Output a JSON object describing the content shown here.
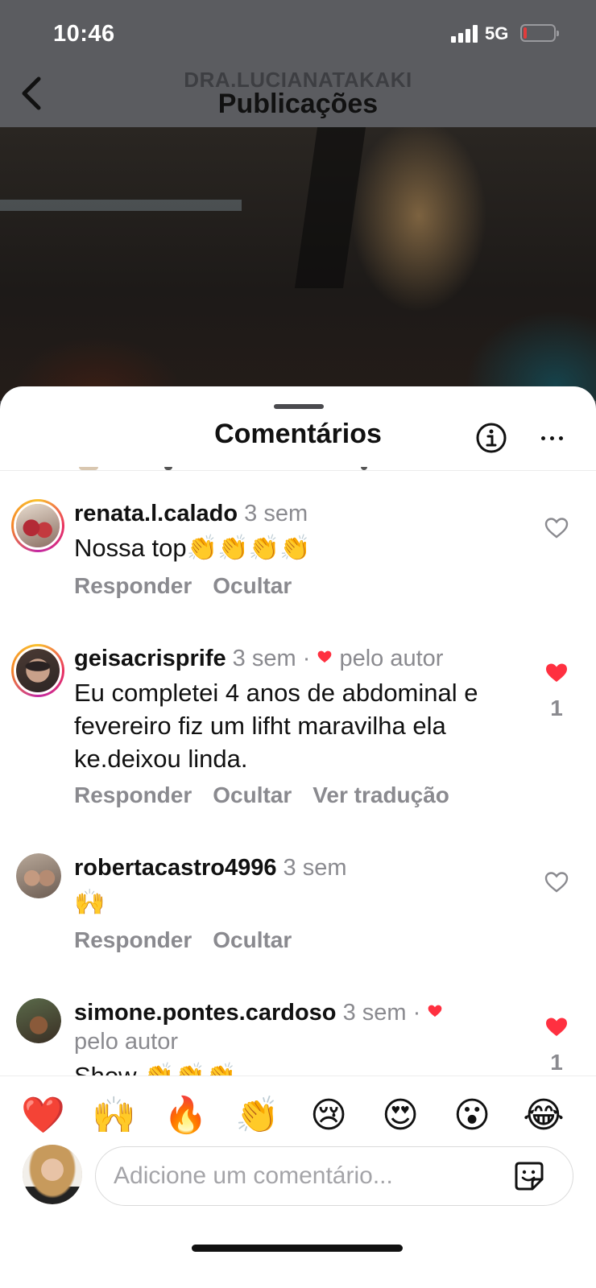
{
  "status_bar": {
    "time": "10:46",
    "network": "5G",
    "battery_icon": "battery-low-icon"
  },
  "header": {
    "account": "DRA.LUCIANATAKAKI",
    "title": "Publicações"
  },
  "sheet": {
    "title": "Comentários"
  },
  "colors": {
    "like_red": "#ff3040",
    "meta_gray": "#8a8a8f"
  },
  "comments": [
    {
      "username": "renata.l.calado",
      "time": "3 sem",
      "text": "Nossa top👏👏👏👏",
      "actions": [
        "Responder",
        "Ocultar"
      ],
      "liked": false,
      "like_count": ""
    },
    {
      "username": "geisacrisprife",
      "time": "3 sem ·",
      "author_like": "pelo autor",
      "text": "Eu completei 4 anos de abdominal e fevereiro fiz um lifht maravilha ela ke.deixou linda.",
      "actions": [
        "Responder",
        "Ocultar",
        "Ver tradução"
      ],
      "liked": true,
      "like_count": "1"
    },
    {
      "username": "robertacastro4996",
      "time": "3 sem",
      "text": "🙌",
      "actions": [
        "Responder",
        "Ocultar"
      ],
      "liked": false,
      "like_count": ""
    },
    {
      "username": "simone.pontes.cardoso",
      "time": "3 sem ·",
      "author_like": "pelo autor",
      "text": "Show 👏👏👏",
      "actions": [],
      "liked": true,
      "like_count": "1"
    }
  ],
  "emoji_bar": [
    "❤️",
    "🙌",
    "🔥",
    "👏",
    "😢",
    "😍",
    "😮",
    "😂"
  ],
  "composer": {
    "placeholder": "Adicione um comentário..."
  }
}
